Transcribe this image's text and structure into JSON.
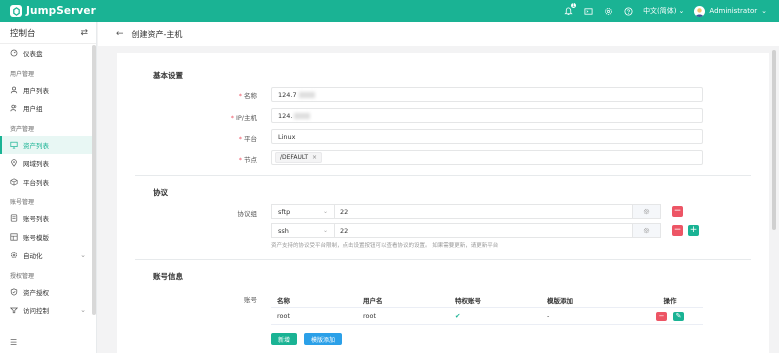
{
  "app": {
    "name": "JumpServer"
  },
  "topbar": {
    "notification_count": "1",
    "language": "中文(简体)",
    "user": "Administrator"
  },
  "sidebar": {
    "title": "控制台",
    "items": [
      {
        "type": "item",
        "label": "仪表盘",
        "icon": "dashboard-icon"
      },
      {
        "type": "group",
        "label": "用户管理"
      },
      {
        "type": "item",
        "label": "用户列表",
        "icon": "user-icon"
      },
      {
        "type": "item",
        "label": "用户组",
        "icon": "user-group-icon"
      },
      {
        "type": "group",
        "label": "资产管理"
      },
      {
        "type": "item",
        "label": "资产列表",
        "icon": "monitor-icon",
        "active": true
      },
      {
        "type": "item",
        "label": "网域列表",
        "icon": "location-icon"
      },
      {
        "type": "item",
        "label": "平台列表",
        "icon": "cube-icon"
      },
      {
        "type": "group",
        "label": "账号管理"
      },
      {
        "type": "item",
        "label": "账号列表",
        "icon": "key-icon"
      },
      {
        "type": "item",
        "label": "账号模版",
        "icon": "template-icon"
      },
      {
        "type": "item",
        "label": "自动化",
        "icon": "automation-icon",
        "expandable": true
      },
      {
        "type": "group",
        "label": "授权管理"
      },
      {
        "type": "item",
        "label": "资产授权",
        "icon": "shield-check-icon"
      },
      {
        "type": "item",
        "label": "访问控制",
        "icon": "access-control-icon",
        "expandable": true
      }
    ]
  },
  "page": {
    "title": "创建资产-主机"
  },
  "basic": {
    "section": "基本设置",
    "name_label": "名称",
    "name_value": "124.7",
    "ip_label": "IP/主机",
    "ip_value": "124.",
    "platform_label": "平台",
    "platform_value": "Linux",
    "node_label": "节点",
    "node_tag": "/DEFAULT",
    "node_tag_close": "×"
  },
  "protocols": {
    "section": "协议",
    "group_label": "协议组",
    "rows": [
      {
        "protocol": "sftp",
        "port": "22"
      },
      {
        "protocol": "ssh",
        "port": "22"
      }
    ],
    "hint": "资产支持的协议受平台限制，点击设置按钮可以查看协议的设置。 如果需要更新，请更新平台"
  },
  "accounts": {
    "section": "账号信息",
    "label": "账号",
    "columns": [
      "名称",
      "用户名",
      "特权账号",
      "模版添加",
      "操作"
    ],
    "rows": [
      {
        "name": "root",
        "username": "root",
        "privileged": "✔",
        "template": "-"
      }
    ],
    "add_button": "新增",
    "template_add_button": "模版添加"
  }
}
